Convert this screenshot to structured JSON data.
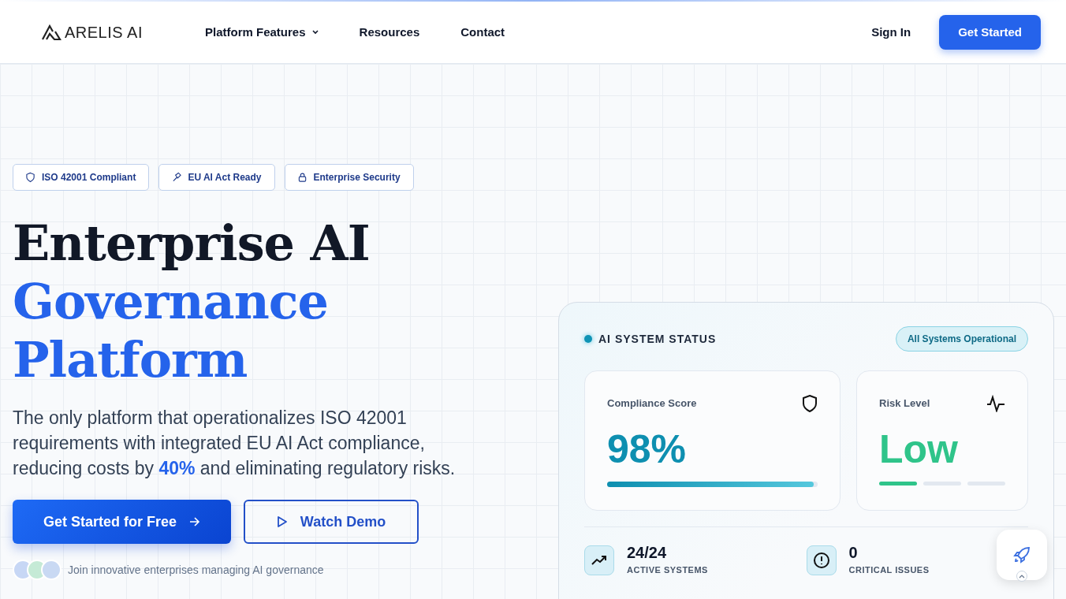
{
  "brand": {
    "name": "ARELIS AI"
  },
  "nav": [
    {
      "label": "Platform Features",
      "dropdown": true
    },
    {
      "label": "Resources",
      "dropdown": false
    },
    {
      "label": "Contact",
      "dropdown": false
    }
  ],
  "auth": {
    "sign_in": "Sign In",
    "cta": "Get Started"
  },
  "badges": [
    {
      "kind": "shield",
      "label": "ISO 42001 Compliant"
    },
    {
      "kind": "gavel",
      "label": "EU AI Act Ready"
    },
    {
      "kind": "lock",
      "label": "Enterprise Security"
    }
  ],
  "headline": {
    "line_1": "Enterprise AI",
    "line_2": "Governance",
    "line_3": "Platform"
  },
  "intro": "The only platform that operationalizes ISO 42001 requirements with integrated EU AI Act compliance, reducing costs by **40%** and eliminating regulatory risks.",
  "actions": {
    "primary": "Get Started for Free",
    "secondary": "Watch Demo"
  },
  "social_proof": "Join innovative enterprises managing AI governance",
  "status_panel": {
    "title": "AI SYSTEM STATUS",
    "status": "All Systems Operational",
    "compliance": {
      "label": "Compliance Score",
      "value": "98%",
      "level": 0.98
    },
    "risk": {
      "label": "Risk Level",
      "value": "Low",
      "level": 0.33
    },
    "stats": [
      {
        "kind": "trend",
        "value": "24/24",
        "label": "ACTIVE SYSTEMS"
      },
      {
        "kind": "alert",
        "value": "0",
        "label": "CRITICAL ISSUES"
      }
    ]
  }
}
